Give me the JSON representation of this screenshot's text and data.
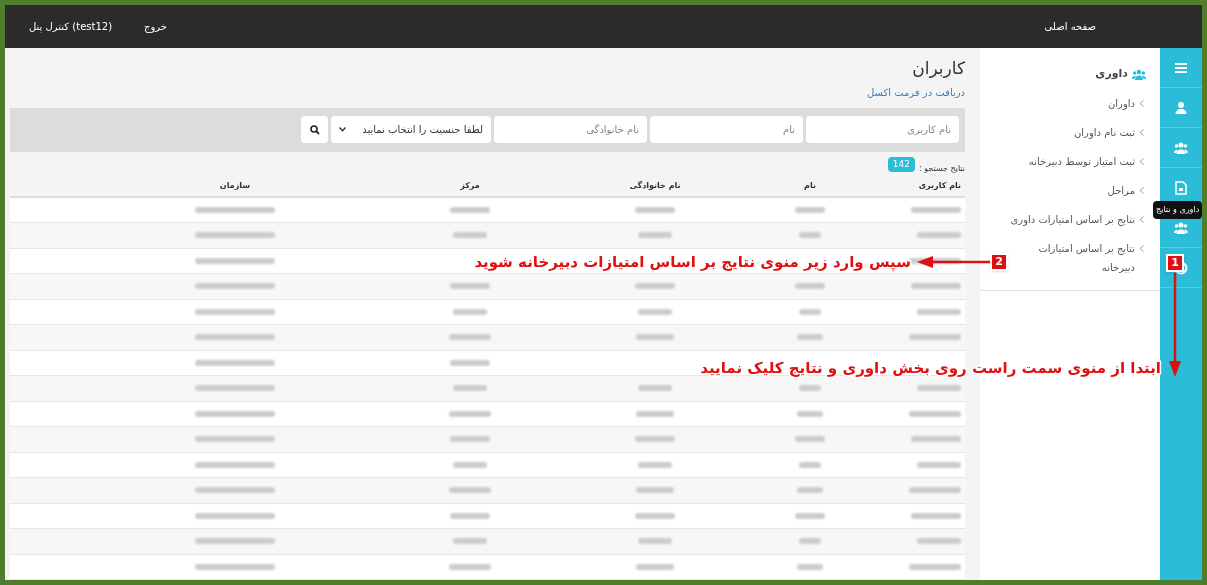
{
  "top_bar": {
    "home_link": "صفحه اصلی",
    "logout_link": "خروج",
    "panel_link": "(test12) کنترل پنل"
  },
  "icon_rail": [
    {
      "kind": "menu"
    },
    {
      "kind": "user"
    },
    {
      "kind": "users"
    },
    {
      "kind": "document"
    },
    {
      "kind": "users"
    },
    {
      "kind": "lifebuoy"
    }
  ],
  "tooltip": "داوری و نتایج",
  "sidebar": {
    "heading": "داوری",
    "items": [
      {
        "label": "داوران"
      },
      {
        "label": "ثبت نام داوران"
      },
      {
        "label": "ثبت امتیاز توسط دبیرخانه"
      },
      {
        "label": "مراحل"
      },
      {
        "label": "نتایج بر اساس امتیازات داوری"
      },
      {
        "label": "نتایج بر اساس امتیازات دبیرخانه"
      }
    ]
  },
  "page_title": "کاربران",
  "excel_link": "دریافت در فرمت اکسل",
  "filters": {
    "username_placeholder": "نام کاربری",
    "first_name_placeholder": "نام",
    "last_name_placeholder": "نام خانوادگی",
    "gender_select": "لطفا جنسیت را انتخاب نمایید"
  },
  "results": {
    "label": "نتایج جستجو :",
    "count": "142"
  },
  "table": {
    "columns": [
      "نام کاربری",
      "نام",
      "نام خانوادگی",
      "مرکز",
      "سازمان"
    ],
    "rows": [
      {
        "kind": "blurred"
      },
      {
        "kind": "blurred"
      },
      {
        "kind": "blurred"
      },
      {
        "kind": "blurred"
      },
      {
        "kind": "blurred"
      },
      {
        "kind": "blurred"
      },
      {
        "kind": "blurred"
      },
      {
        "kind": "blurred"
      },
      {
        "kind": "blurred"
      },
      {
        "kind": "blurred"
      },
      {
        "kind": "blurred"
      },
      {
        "kind": "blurred"
      },
      {
        "kind": "blurred"
      },
      {
        "kind": "blurred"
      },
      {
        "kind": "blurred"
      }
    ]
  },
  "annotations": [
    {
      "badge": "1",
      "text": "ابتدا از منوی سمت راست روی بخش داوری و نتایج کلیک نمایید"
    },
    {
      "badge": "2",
      "text": "سپس وارد زیر منوی نتایج بر اساس امتیازات دبیرخانه شوید"
    }
  ]
}
